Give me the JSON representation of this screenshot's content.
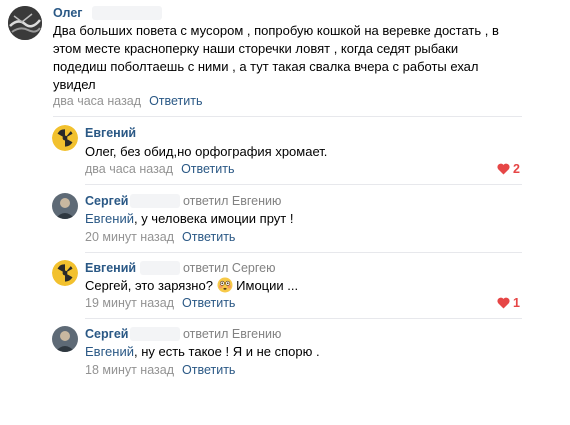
{
  "comments": [
    {
      "author": "Олег",
      "lines": [
        "Два больших повета с мусором , попробую кошкой на веревке достать , в",
        "этом месте красноперку наши сторечки ловят , когда седят рыбаки",
        "подедиш поболтаешь с ними , а тут такая свалка вчера с работы ехал",
        "увидел"
      ],
      "time": "два часа назад",
      "reply_label": "Ответить"
    },
    {
      "author": "Евгений",
      "text": "Олег, без обид,но орфография хромает.",
      "time": "два часа назад",
      "reply_label": "Ответить",
      "likes": "2"
    },
    {
      "author": "Сергей",
      "reply_to": "ответил Евгению",
      "mention": "Евгений",
      "text": ", у человека имоции прут !",
      "time": "20 минут назад",
      "reply_label": "Ответить"
    },
    {
      "author": "Евгений",
      "reply_to": "ответил Сергею",
      "text_before": "Сергей, это зарязно?",
      "text_after": " Имоции ...",
      "time": "19 минут назад",
      "reply_label": "Ответить",
      "likes": "1"
    },
    {
      "author": "Сергей",
      "reply_to": "ответил Евгению",
      "mention": "Евгений",
      "text": ", ну есть такое ! Я и не спорю .",
      "time": "18 минут назад",
      "reply_label": "Ответить"
    }
  ],
  "icons": {
    "avatar_oleg": "oleg-avatar",
    "avatar_evgeny": "radiation-avatar",
    "avatar_sergey": "sergey-avatar",
    "like": "heart-icon",
    "emoji": "flushed-face-emoji"
  },
  "colors": {
    "link": "#2a5885",
    "meta": "#939393",
    "like": "#e64646"
  }
}
